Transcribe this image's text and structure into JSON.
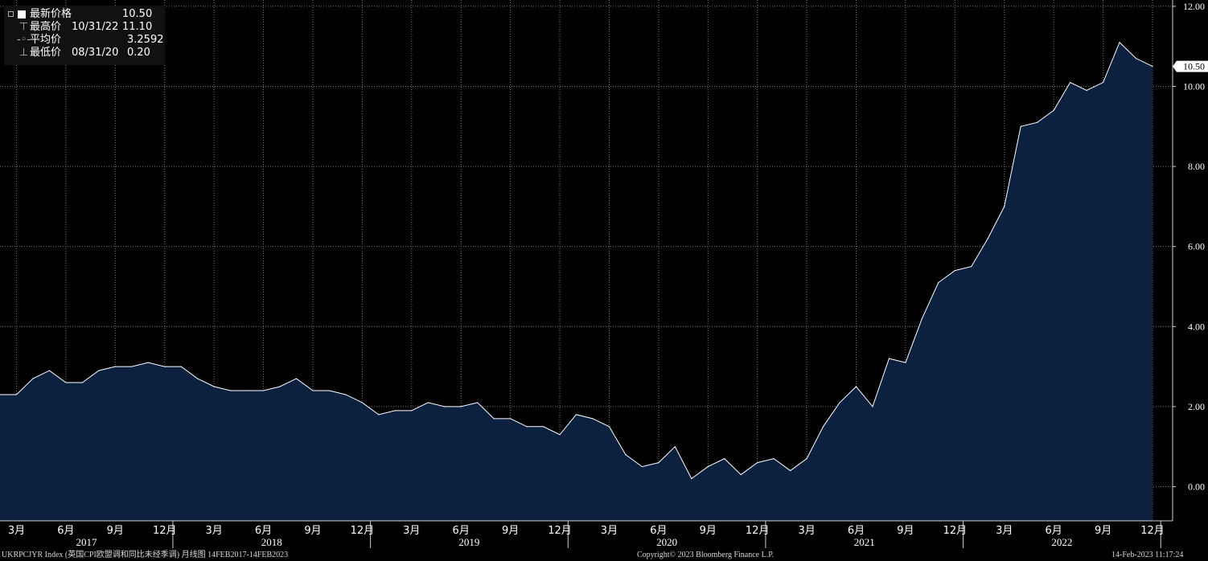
{
  "legend": {
    "items": [
      {
        "label": "最新价格",
        "date": "",
        "value": "10.50"
      },
      {
        "label": "最高价",
        "date": "10/31/22",
        "value": "11.10"
      },
      {
        "label": "平均价",
        "date": "",
        "value": "3.2592"
      },
      {
        "label": "最低价",
        "date": "08/31/20",
        "value": "0.20"
      }
    ]
  },
  "last_price_tag": "10.50",
  "footer": {
    "left": "UKRPCJYR Index (英国CPI欧盟调和同比未经季调) 月线图 14FEB2017-14FEB2023",
    "center": "Copyright© 2023 Bloomberg Finance L.P.",
    "right": "14-Feb-2023 11:17:24"
  },
  "colors": {
    "background": "#000000",
    "area_fill": "#0c2140",
    "line": "#ffffff",
    "grid": "#7a7a7a",
    "last_tag_bg": "#ffffff"
  },
  "chart_data": {
    "type": "area",
    "x": [
      "2017-02",
      "2017-03",
      "2017-04",
      "2017-05",
      "2017-06",
      "2017-07",
      "2017-08",
      "2017-09",
      "2017-10",
      "2017-11",
      "2017-12",
      "2018-01",
      "2018-02",
      "2018-03",
      "2018-04",
      "2018-05",
      "2018-06",
      "2018-07",
      "2018-08",
      "2018-09",
      "2018-10",
      "2018-11",
      "2018-12",
      "2019-01",
      "2019-02",
      "2019-03",
      "2019-04",
      "2019-05",
      "2019-06",
      "2019-07",
      "2019-08",
      "2019-09",
      "2019-10",
      "2019-11",
      "2019-12",
      "2020-01",
      "2020-02",
      "2020-03",
      "2020-04",
      "2020-05",
      "2020-06",
      "2020-07",
      "2020-08",
      "2020-09",
      "2020-10",
      "2020-11",
      "2020-12",
      "2021-01",
      "2021-02",
      "2021-03",
      "2021-04",
      "2021-05",
      "2021-06",
      "2021-07",
      "2021-08",
      "2021-09",
      "2021-10",
      "2021-11",
      "2021-12",
      "2022-01",
      "2022-02",
      "2022-03",
      "2022-04",
      "2022-05",
      "2022-06",
      "2022-07",
      "2022-08",
      "2022-09",
      "2022-10",
      "2022-11",
      "2022-12"
    ],
    "series": [
      {
        "values": [
          2.3,
          2.3,
          2.7,
          2.9,
          2.6,
          2.6,
          2.9,
          3.0,
          3.0,
          3.1,
          3.0,
          3.0,
          2.7,
          2.5,
          2.4,
          2.4,
          2.4,
          2.5,
          2.7,
          2.4,
          2.4,
          2.3,
          2.1,
          1.8,
          1.9,
          1.9,
          2.1,
          2.0,
          2.0,
          2.1,
          1.7,
          1.7,
          1.5,
          1.5,
          1.3,
          1.8,
          1.7,
          1.5,
          0.8,
          0.5,
          0.6,
          1.0,
          0.2,
          0.5,
          0.7,
          0.3,
          0.6,
          0.7,
          0.4,
          0.7,
          1.5,
          2.1,
          2.5,
          2.0,
          3.2,
          3.1,
          4.2,
          5.1,
          5.4,
          5.5,
          6.2,
          7.0,
          9.0,
          9.1,
          9.4,
          10.1,
          9.9,
          10.1,
          11.1,
          10.7,
          10.5
        ]
      }
    ],
    "ylim": [
      -0.85,
      12.05
    ],
    "yticks": [
      "0.00",
      "2.00",
      "4.00",
      "6.00",
      "8.00",
      "10.00",
      "12.00"
    ],
    "month_labels": [
      "3月",
      "6月",
      "9月",
      "12月"
    ],
    "years": [
      "2017",
      "2018",
      "2019",
      "2020",
      "2021",
      "2022"
    ],
    "grid": true
  }
}
